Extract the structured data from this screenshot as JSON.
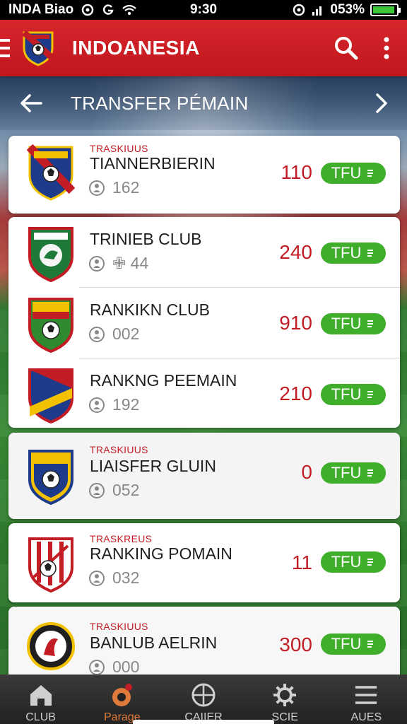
{
  "status_bar": {
    "carrier": "INDA Biao",
    "time": "9:30",
    "battery_pct": "053%",
    "battery_level": 0.95
  },
  "app_bar": {
    "title": "INDOANESIA",
    "icons": [
      "menu-icon",
      "club-logo",
      "search-icon",
      "more-vert-icon"
    ]
  },
  "sub_header": {
    "title": "TRANSFER PÉMAIN",
    "back_icon": "arrow-left-icon",
    "forward_icon": "chevron-right-icon"
  },
  "transfers": [
    {
      "tag": "TRASKIUUS",
      "name": "TIANNERBIERIN",
      "count": "162",
      "value": "110",
      "badge": "TFU",
      "crest_colors": [
        "#1e3a8a",
        "#c21d25",
        "#f2c200"
      ]
    },
    {
      "tag": "",
      "name": "TRINIEB CLUB",
      "count": "✙ 44",
      "value": "240",
      "badge": "TFU",
      "crest_colors": [
        "#1f7a3a",
        "#c21d25",
        "#f5f5f5"
      ]
    },
    {
      "tag": "",
      "name": "RANKIKN CLUB",
      "count": "002",
      "value": "910",
      "badge": "TFU",
      "crest_colors": [
        "#2f8a2f",
        "#c21d25",
        "#f2c200"
      ]
    },
    {
      "tag": "",
      "name": "RANKNG PEEMAIN",
      "count": "192",
      "value": "210",
      "badge": "TFU",
      "crest_colors": [
        "#1e3a8a",
        "#c21d25",
        "#f2c200"
      ]
    },
    {
      "tag": "TRASKIUUS",
      "name": "LIAISFER GLUIN",
      "count": "052",
      "value": "0",
      "badge": "TFU",
      "crest_colors": [
        "#1e3a8a",
        "#f2c200",
        "#c21d25"
      ]
    },
    {
      "tag": "TRASKREUS",
      "name": "RANKING POMAIN",
      "count": "032",
      "value": "11",
      "badge": "TFU",
      "crest_colors": [
        "#c21d25",
        "#ffffff",
        "#1f7a3a"
      ]
    },
    {
      "tag": "TRASKIUUS",
      "name": "BANLUB AELRIN",
      "count": "000",
      "value": "300",
      "badge": "TFU",
      "crest_colors": [
        "#1f1f1f",
        "#f2c200",
        "#c21d25"
      ]
    }
  ],
  "bottom_nav": [
    {
      "label": "CLUB",
      "icon": "home-icon",
      "active": false
    },
    {
      "label": "Parage",
      "icon": "pin-icon",
      "active": true
    },
    {
      "label": "CAIIER",
      "icon": "crosshair-icon",
      "active": false
    },
    {
      "label": "SCIE",
      "icon": "gear-icon",
      "active": false
    },
    {
      "label": "AUES",
      "icon": "list-icon",
      "active": false
    }
  ],
  "colors": {
    "primary_red": "#c8191f",
    "accent_green": "#3fae2a",
    "value_red": "#c21d25"
  }
}
